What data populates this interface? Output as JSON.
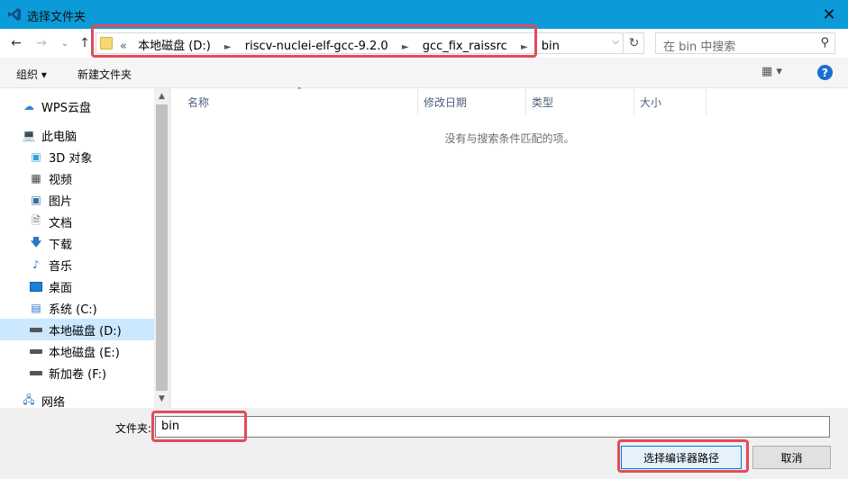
{
  "window": {
    "title": "选择文件夹",
    "close_label": "✕"
  },
  "nav": {
    "back": "←",
    "forward": "→",
    "history": "⌄",
    "up": "↑",
    "breadcrumb_overflow": "«",
    "breadcrumbs": [
      "本地磁盘 (D:)",
      "riscv-nuclei-elf-gcc-9.2.0",
      "gcc_fix_raissrc",
      "bin"
    ],
    "search_placeholder": "在 bin 中搜索"
  },
  "toolbar": {
    "organize": "组织 ▾",
    "new_folder": "新建文件夹",
    "view": "▦ ▾",
    "help": "?"
  },
  "tree": [
    {
      "label": "WPS云盘",
      "icon": "cloud-icon"
    },
    {
      "label": "此电脑",
      "icon": "computer-icon"
    },
    {
      "label": "3D 对象",
      "icon": "3d-objects-icon"
    },
    {
      "label": "视频",
      "icon": "video-icon"
    },
    {
      "label": "图片",
      "icon": "pictures-icon"
    },
    {
      "label": "文档",
      "icon": "documents-icon"
    },
    {
      "label": "下载",
      "icon": "download-icon"
    },
    {
      "label": "音乐",
      "icon": "music-icon"
    },
    {
      "label": "桌面",
      "icon": "desktop-icon"
    },
    {
      "label": "系统 (C:)",
      "icon": "system-drive-icon"
    },
    {
      "label": "本地磁盘 (D:)",
      "icon": "drive-icon",
      "selected": true
    },
    {
      "label": "本地磁盘 (E:)",
      "icon": "drive-icon"
    },
    {
      "label": "新加卷 (F:)",
      "icon": "drive-icon"
    },
    {
      "label": "网络",
      "icon": "network-icon"
    }
  ],
  "columns": [
    "名称",
    "修改日期",
    "类型",
    "大小"
  ],
  "empty_message": "没有与搜索条件匹配的项。",
  "footer": {
    "folder_label": "文件夹:",
    "folder_value": "bin",
    "select_button": "选择编译器路径",
    "cancel_button": "取消"
  },
  "colors": {
    "titlebar": "#0a9bd8",
    "highlight": "#e24b5a",
    "selection": "#cce8ff"
  }
}
